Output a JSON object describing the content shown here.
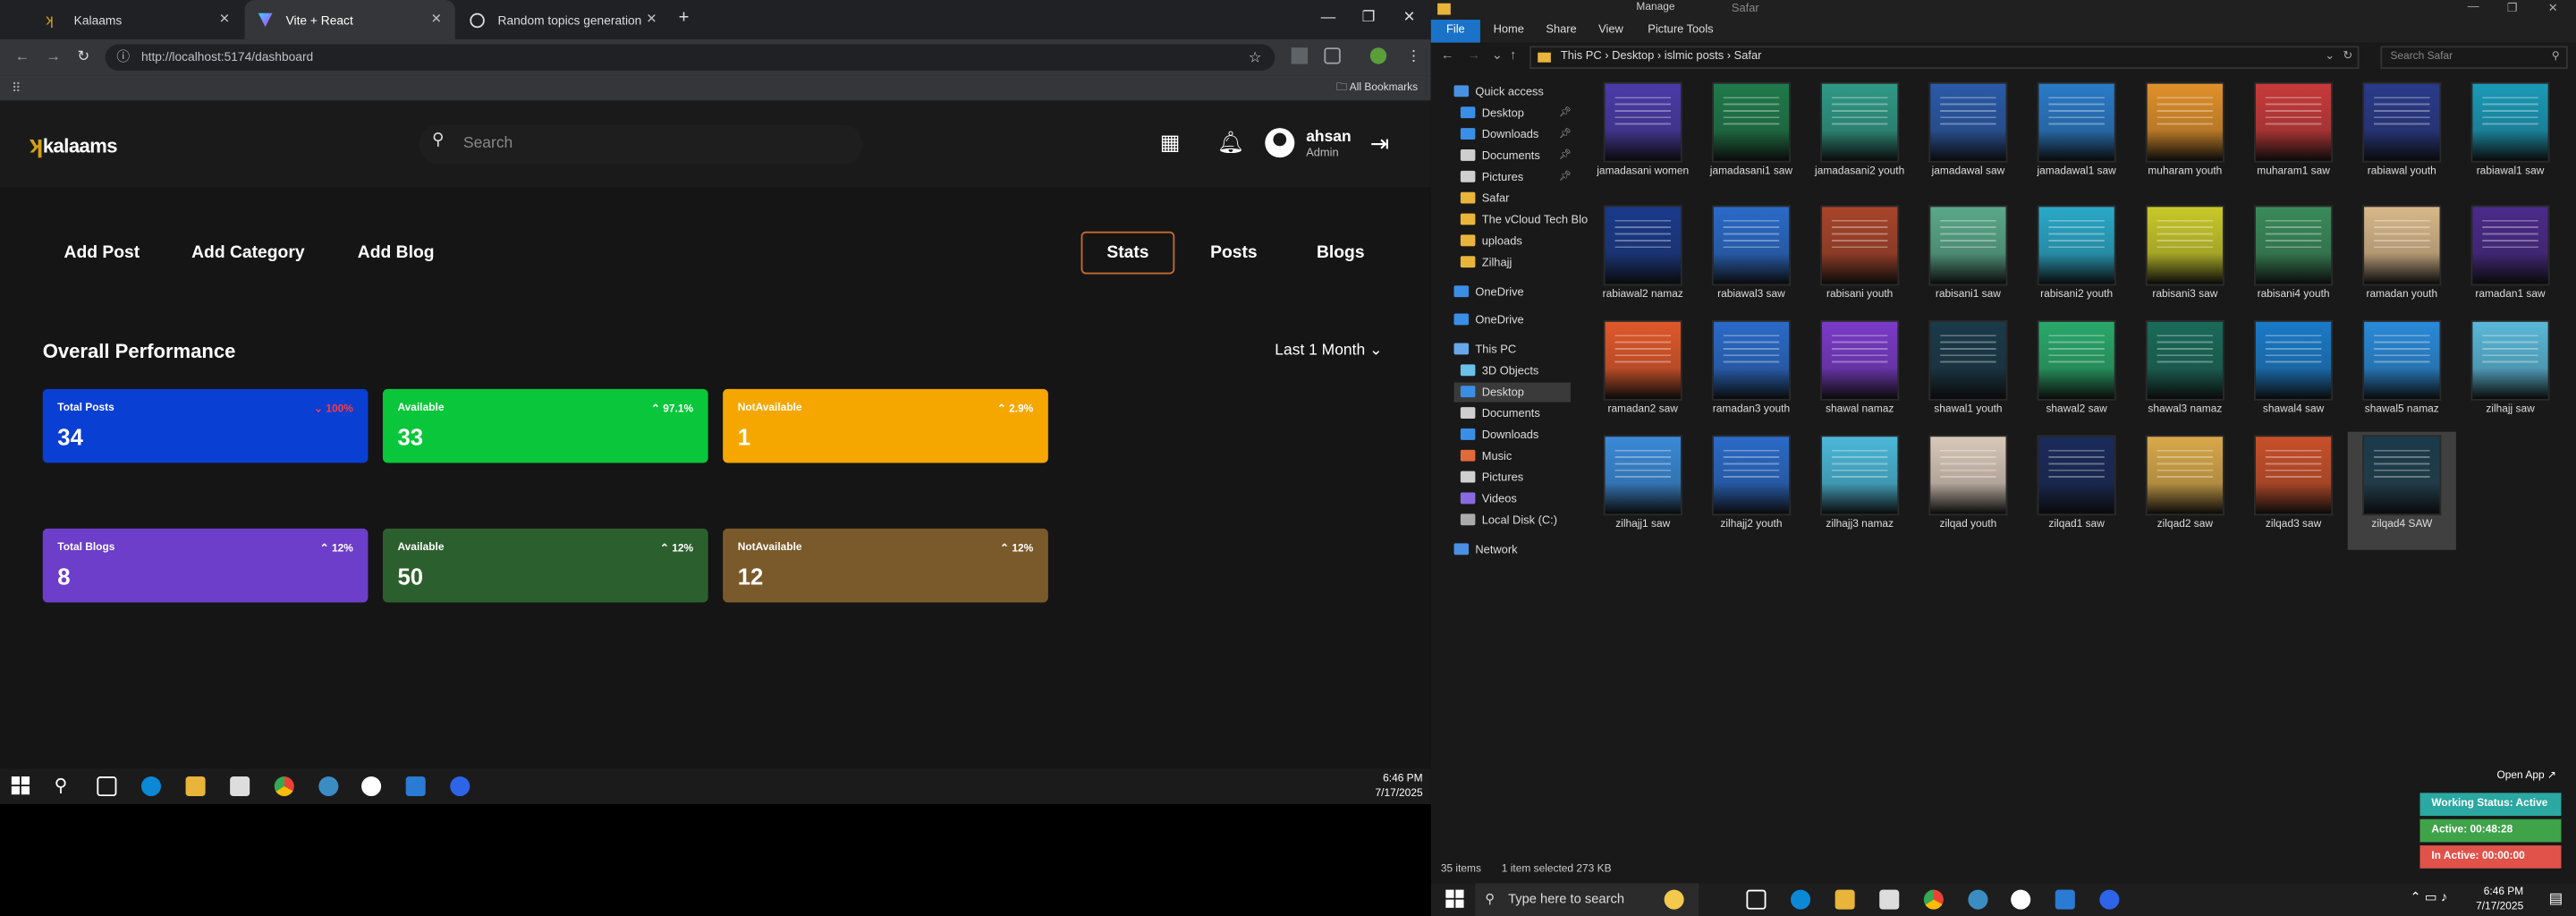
{
  "browser": {
    "tabs": [
      {
        "label": "Kalaams"
      },
      {
        "label": "Vite + React"
      },
      {
        "label": "Random topics generation"
      }
    ],
    "url": "http://localhost:5174/dashboard",
    "all_bookmarks": "All Bookmarks"
  },
  "app": {
    "logo": "kalaams",
    "search_placeholder": "Search",
    "user": {
      "name": "ahsan",
      "role": "Admin"
    },
    "buttons": [
      "Add Post",
      "Add Category",
      "Add Blog"
    ],
    "tabs": [
      "Stats",
      "Posts",
      "Blogs"
    ],
    "section_title": "Overall Performance",
    "period": "Last 1 Month",
    "cards": [
      {
        "label": "Total Posts",
        "value": "34",
        "pct": "100%",
        "color": "#0a3fd4"
      },
      {
        "label": "Available",
        "value": "33",
        "pct": "97.1%",
        "color": "#09c63a"
      },
      {
        "label": "NotAvailable",
        "value": "1",
        "pct": "2.9%",
        "color": "#f5a700"
      },
      {
        "label": "Total Blogs",
        "value": "8",
        "pct": "12%",
        "color": "#6d3ec9"
      },
      {
        "label": "Available",
        "value": "50",
        "pct": "12%",
        "color": "#2c5f2e"
      },
      {
        "label": "NotAvailable",
        "value": "12",
        "pct": "12%",
        "color": "#7a5a2a"
      }
    ]
  },
  "taskbar_left": {
    "time": "6:46 PM",
    "date": "7/17/2025"
  },
  "explorer": {
    "ribbon_manage": "Manage",
    "window_title": "Safar",
    "ribbon": [
      "File",
      "Home",
      "Share",
      "View",
      "Picture Tools"
    ],
    "breadcrumb": [
      "This PC",
      "Desktop",
      "islmic posts",
      "Safar"
    ],
    "search_placeholder": "Search Safar",
    "tree": [
      "Quick access",
      "Desktop",
      "Downloads",
      "Documents",
      "Pictures",
      "Safar",
      "The vCloud Tech Blo",
      "uploads",
      "Zilhajj",
      "OneDrive",
      "OneDrive",
      "This PC",
      "3D Objects",
      "Desktop",
      "Documents",
      "Downloads",
      "Music",
      "Pictures",
      "Videos",
      "Local Disk (C:)",
      "Network"
    ],
    "files": [
      "jamadasani women",
      "jamadasani1 saw",
      "jamadasani2 youth",
      "jamadawal saw",
      "jamadawal1 saw",
      "muharam youth",
      "muharam1 saw",
      "rabiawal youth",
      "rabiawal1 saw",
      "rabiawal2 namaz",
      "rabiawal3 saw",
      "rabisani youth",
      "rabisani1 saw",
      "rabisani2 youth",
      "rabisani3 saw",
      "rabisani4 youth",
      "ramadan youth",
      "ramadan1 saw",
      "ramadan2 saw",
      "ramadan3 youth",
      "shawal namaz",
      "shawal1 youth",
      "shawal2 saw",
      "shawal3 namaz",
      "shawal4 saw",
      "shawal5 namaz",
      "zilhajj saw",
      "zilhajj1 saw",
      "zilhajj2 youth",
      "zilhajj3 namaz",
      "zilqad youth",
      "zilqad1 saw",
      "zilqad2 saw",
      "zilqad3 saw",
      "zilqad4 SAW"
    ],
    "status": {
      "count": "35 items",
      "selected": "1 item selected  273 KB"
    }
  },
  "widget": {
    "open_app": "Open App",
    "status": "Working Status: Active",
    "active": "Active: 00:48:28",
    "inactive": "In Active: 00:00:00"
  },
  "taskbar_right": {
    "search": "Type here to search",
    "time": "6:46 PM",
    "date": "7/17/2025"
  }
}
